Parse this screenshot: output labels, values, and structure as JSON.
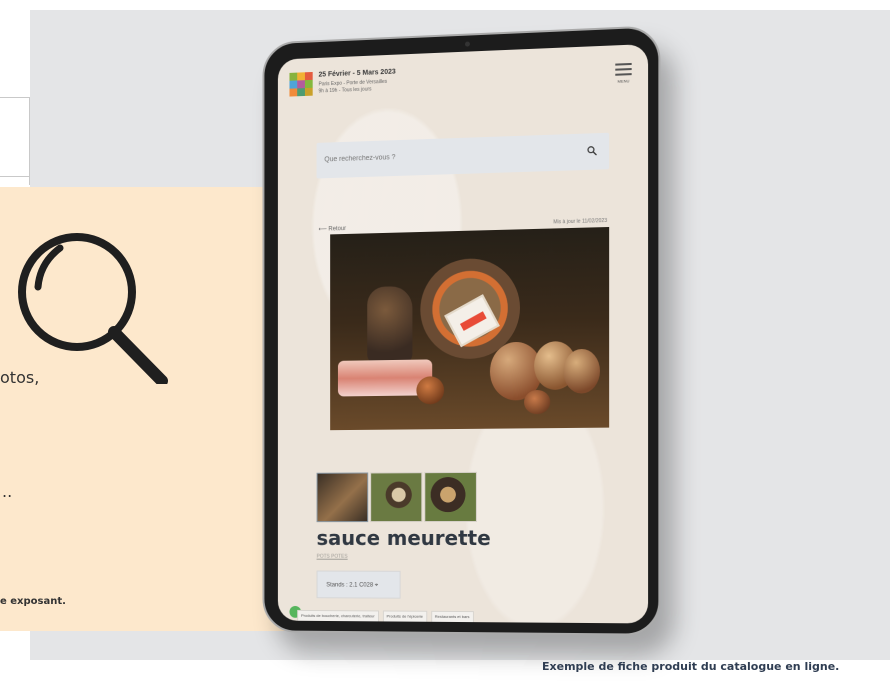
{
  "panel": {
    "text_1": "otos,",
    "text_2": "..",
    "text_3": "e exposant."
  },
  "tablet": {
    "header": {
      "date": "25 Février - 5 Mars 2023",
      "place": "Paris Expo - Porte de Versailles",
      "hours": "9h à 19h - Tous les jours",
      "menu_label": "MENU"
    },
    "search": {
      "placeholder": "Que recherchez-vous ?"
    },
    "navigation": {
      "back": "Retour",
      "updated": "Mis à jour le 11/02/2023"
    },
    "product": {
      "title": "sauce meurette",
      "category": "POTS POTES",
      "stands": "Stands : 2.1 C028"
    },
    "tags": [
      "Produits de boucherie, charcuterie, traiteur",
      "Produits de l'épicerie",
      "Restaurants et bars"
    ]
  },
  "caption": "Exemple de fiche produit du catalogue en ligne.",
  "colors": {
    "accent": "#56b55d",
    "panel": "#fde8cc",
    "text": "#2f3d52"
  }
}
